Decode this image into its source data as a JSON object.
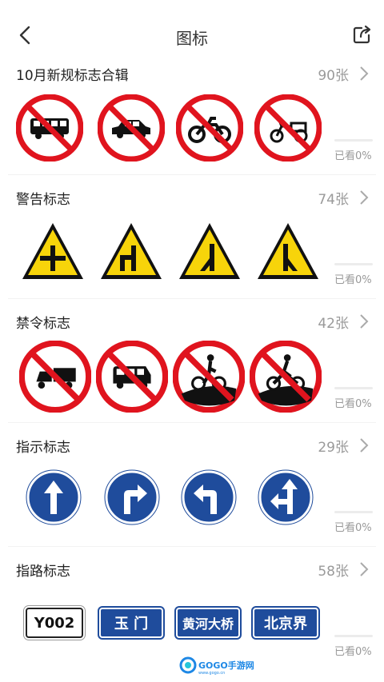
{
  "header": {
    "title": "图标",
    "back_icon": "chevron-left-icon",
    "share_icon": "share-icon"
  },
  "sections": [
    {
      "title": "10月新规标志合辑",
      "count": "90张",
      "seen": "已看0%",
      "progress": 0,
      "signs": [
        "prohibit-bus",
        "prohibit-car",
        "prohibit-motorcycle",
        "prohibit-electric-tricycle"
      ]
    },
    {
      "title": "警告标志",
      "count": "74张",
      "seen": "已看0%",
      "progress": 0,
      "signs": [
        "warning-crossroad",
        "warning-side-road-left",
        "warning-merge-left",
        "warning-merge-right"
      ]
    },
    {
      "title": "禁令标志",
      "count": "42张",
      "seen": "已看0%",
      "progress": 0,
      "signs": [
        "prohibit-tricycle-truck",
        "prohibit-van",
        "prohibit-pushing-bicycle",
        "prohibit-riding-bicycle"
      ]
    },
    {
      "title": "指示标志",
      "count": "29张",
      "seen": "已看0%",
      "progress": 0,
      "signs": [
        "mandatory-straight",
        "mandatory-turn-right",
        "mandatory-turn-left",
        "mandatory-straight-or-left"
      ]
    },
    {
      "title": "指路标志",
      "count": "58张",
      "seen": "已看0%",
      "progress": 0,
      "road_signs": [
        {
          "text": "Y002",
          "style": "white"
        },
        {
          "text": "玉  门",
          "style": "blue"
        },
        {
          "text": "黄河大桥",
          "style": "blue"
        },
        {
          "text": "北京界",
          "style": "blue"
        }
      ]
    }
  ],
  "watermark": {
    "text": "GOGO手游网",
    "sub": "www.gogo.cn"
  },
  "colors": {
    "red": "#e0141e",
    "yellow": "#f7d40a",
    "blue": "#1f4c9c",
    "progress": "#7ab3ff"
  }
}
